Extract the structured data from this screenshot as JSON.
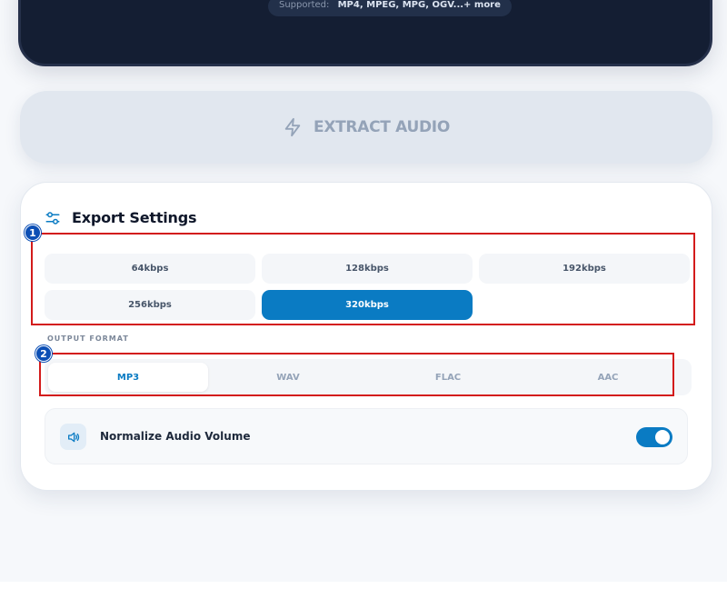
{
  "upload": {
    "supported_label": "Supported:",
    "supported_formats": "MP4, MPEG, MPG, OGV...+ more"
  },
  "extract_button": {
    "label": "EXTRACT AUDIO",
    "icon": "lightning-icon"
  },
  "export_settings": {
    "title": "Export Settings",
    "icon": "sliders-icon",
    "bitrates": [
      {
        "label": "64kbps",
        "selected": false
      },
      {
        "label": "128kbps",
        "selected": false
      },
      {
        "label": "192kbps",
        "selected": false
      },
      {
        "label": "256kbps",
        "selected": false
      },
      {
        "label": "320kbps",
        "selected": true
      }
    ],
    "output_format_label": "OUTPUT FORMAT",
    "formats": [
      {
        "label": "MP3",
        "selected": true
      },
      {
        "label": "WAV",
        "selected": false
      },
      {
        "label": "FLAC",
        "selected": false
      },
      {
        "label": "AAC",
        "selected": false
      }
    ],
    "normalize": {
      "label": "Normalize Audio Volume",
      "icon": "speaker-icon",
      "enabled": true
    }
  },
  "annotations": [
    {
      "number": "1"
    },
    {
      "number": "2"
    }
  ],
  "colors": {
    "accent": "#0a7bc3",
    "annotation_box": "#d31b1b",
    "annotation_badge": "#0c4fb5",
    "dark_card": "#141e33"
  }
}
